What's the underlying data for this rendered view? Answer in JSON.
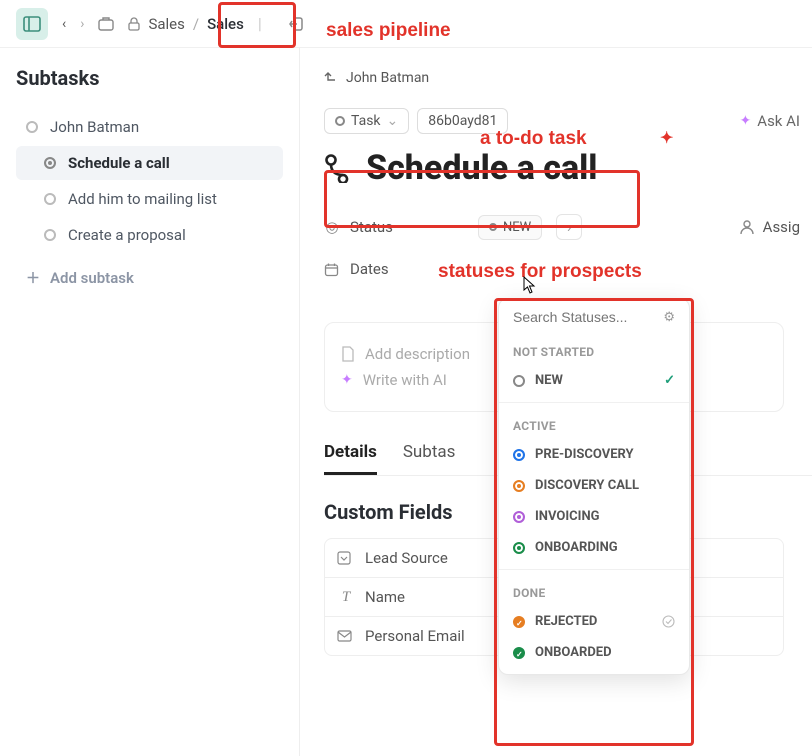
{
  "topbar": {
    "crumb_space": "Sales",
    "crumb_active": "Sales"
  },
  "left": {
    "title": "Subtasks",
    "items": [
      {
        "label": "John Batman"
      },
      {
        "label": "Schedule a call"
      },
      {
        "label": "Add him to mailing list"
      },
      {
        "label": "Create a proposal"
      }
    ],
    "add_label": "Add subtask"
  },
  "right": {
    "parent": "John Batman",
    "type_label": "Task",
    "task_id": "86b0ayd81",
    "askai": "Ask AI",
    "title": "Schedule a call",
    "props": {
      "status_label": "Status",
      "status_value": "NEW",
      "dates_label": "Dates",
      "assignees_label": "Assig"
    },
    "desc": {
      "placeholder": "Add description",
      "ai": "Write with AI"
    },
    "tabs": {
      "details": "Details",
      "subtasks": "Subtas"
    },
    "custom_fields": {
      "title": "Custom Fields",
      "fields": [
        {
          "icon": "☑",
          "label": "Lead Source"
        },
        {
          "icon": "T",
          "label": "Name"
        },
        {
          "icon": "✉",
          "label": "Personal Email"
        }
      ]
    }
  },
  "popover": {
    "search_placeholder": "Search Statuses...",
    "groups": [
      {
        "label": "NOT STARTED",
        "items": [
          {
            "name": "NEW",
            "cls": "new",
            "checked": true
          }
        ]
      },
      {
        "label": "ACTIVE",
        "items": [
          {
            "name": "PRE-DISCOVERY",
            "cls": "prediscovery"
          },
          {
            "name": "DISCOVERY CALL",
            "cls": "discovery"
          },
          {
            "name": "INVOICING",
            "cls": "invoicing"
          },
          {
            "name": "ONBOARDING",
            "cls": "onboarding"
          }
        ]
      },
      {
        "label": "DONE",
        "items": [
          {
            "name": "REJECTED",
            "cls": "rejected",
            "doneCheck": true
          },
          {
            "name": "ONBOARDED",
            "cls": "onboarded"
          }
        ]
      }
    ]
  },
  "annotations": {
    "a1": "sales pipeline",
    "a2": "a to-do task",
    "a3": "statuses for prospects"
  }
}
